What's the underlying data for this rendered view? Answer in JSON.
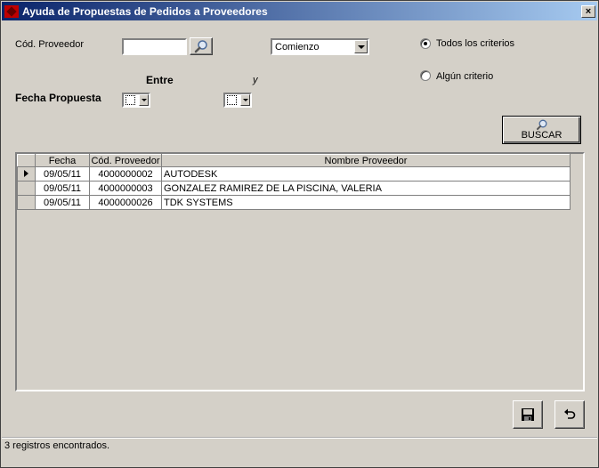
{
  "window": {
    "title": "Ayuda de Propuestas de Pedidos a Proveedores",
    "close_glyph": "×"
  },
  "form": {
    "cod_proveedor_label": "Cód. Proveedor",
    "cod_proveedor_value": "",
    "match_mode": "Comienzo",
    "entre_label": "Entre",
    "y_label": "y",
    "fecha_propuesta_label": "Fecha Propuesta",
    "radio_todos": "Todos los criterios",
    "radio_algun": "Algún criterio",
    "selected_radio": "todos",
    "buscar_label": "BUSCAR"
  },
  "grid": {
    "columns": [
      "Fecha",
      "Cód. Proveedor",
      "Nombre Proveedor"
    ],
    "rows": [
      {
        "fecha": "09/05/11",
        "codigo": "4000000002",
        "nombre": "AUTODESK"
      },
      {
        "fecha": "09/05/11",
        "codigo": "4000000003",
        "nombre": "GONZALEZ RAMIREZ DE LA PISCINA, VALERIA"
      },
      {
        "fecha": "09/05/11",
        "codigo": "4000000026",
        "nombre": "TDK SYSTEMS"
      }
    ],
    "current_row": 0
  },
  "status": {
    "text": "3 registros encontrados."
  },
  "icons": {
    "search": "magnifier-icon",
    "save": "floppy-disk-icon",
    "undo": "undo-arrow-icon"
  }
}
